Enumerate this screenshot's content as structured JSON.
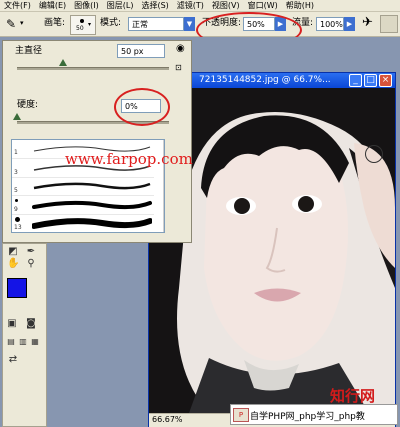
{
  "menu": [
    "文件(F)",
    "编辑(E)",
    "图像(I)",
    "图层(L)",
    "选择(S)",
    "滤镜(T)",
    "视图(V)",
    "窗口(W)",
    "帮助(H)"
  ],
  "options_bar": {
    "brush_label": "画笔:",
    "brush_size": "50",
    "mode_label": "模式:",
    "mode_value": "正常",
    "opacity_label": "不透明度:",
    "opacity_value": "50%",
    "flow_label": "流量:",
    "flow_value": "100%"
  },
  "brush_panel": {
    "master_diameter_label": "主直径",
    "master_diameter_value": "50 px",
    "hardness_label": "硬度:",
    "hardness_value": "0%",
    "brush_numbers": [
      "1",
      "3",
      "5",
      "9",
      "13"
    ],
    "master_diameter_level": 0.3,
    "hardness_level": 0.0
  },
  "image_window": {
    "title": "72135144852.jpg @ 66.7%...",
    "zoom": "66.67%"
  },
  "watermark": "www.farpop.com",
  "corner_brand": "知行网",
  "banner_text": "自学PHP网_php学习_php教",
  "colors": {
    "foreground": "#1414e6",
    "background": "#ffffff",
    "annotation_red": "#d82020",
    "titlebar_blue": "#0a46d6"
  }
}
